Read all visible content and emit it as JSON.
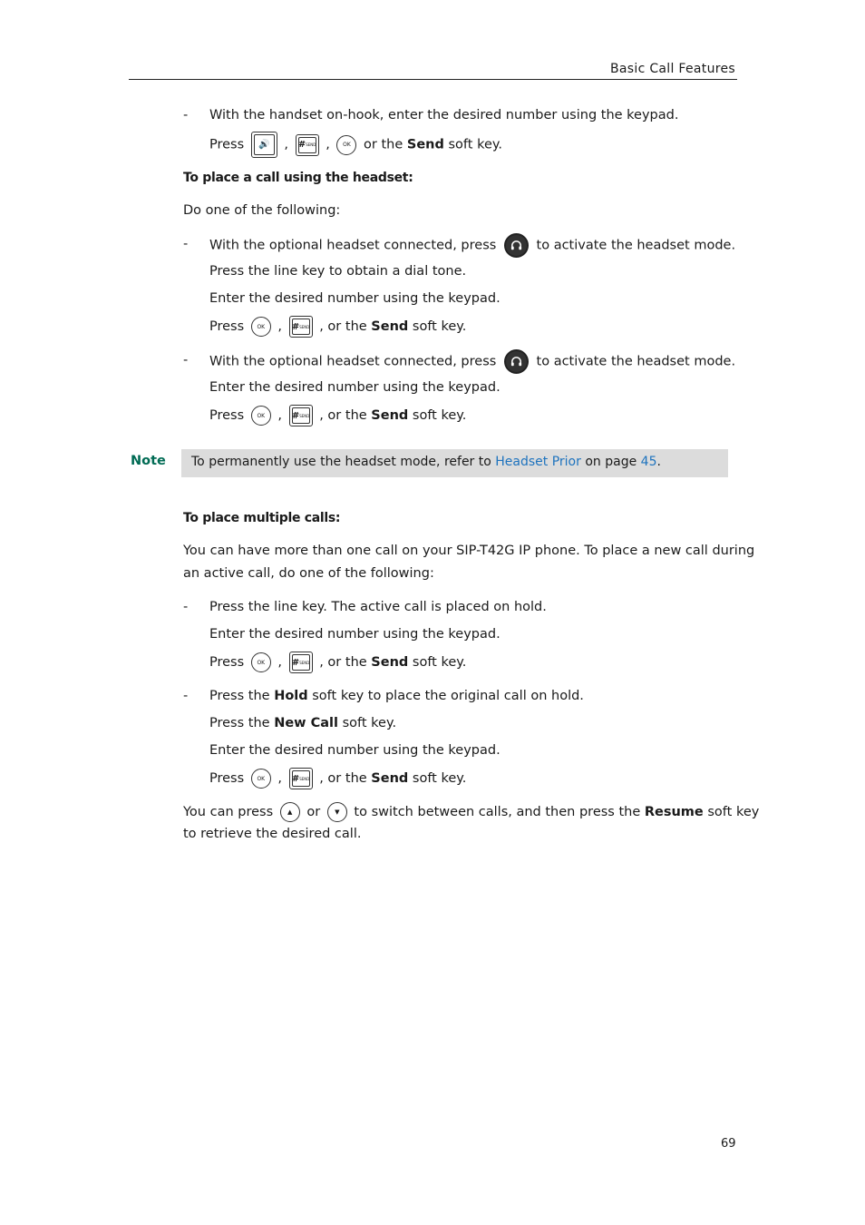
{
  "header": {
    "title": "Basic Call Features"
  },
  "section1": {
    "item_handset_text": "With the handset on-hook, enter the desired number using the keypad.",
    "press": "Press",
    "sep": ",",
    "or_the": "or the",
    "send": "Send",
    "soft_key": "soft key.",
    "comma_or_the": ", or the"
  },
  "headset": {
    "heading": "To place a call using the headset:",
    "intro": "Do one of the following:",
    "item1": {
      "text_before": "With the optional headset connected, press",
      "text_after": "to activate the headset mode.",
      "line2": "Press the line key to obtain a dial tone.",
      "line3": "Enter the desired number using the keypad."
    },
    "item2": {
      "text_before": "With the optional headset connected, press",
      "text_after": "to activate the headset mode.",
      "line2": "Enter the desired number using the keypad."
    }
  },
  "note": {
    "label": "Note",
    "text_before": "To permanently use the headset mode, refer to",
    "link": "Headset Prior",
    "text_mid": "on page",
    "page_link": "45",
    "text_end": "."
  },
  "multiple": {
    "heading": "To place multiple calls:",
    "intro_line1": "You can have more than one call on your SIP-T42G IP phone. To place a new call during",
    "intro_line2": "an active call, do one of the following:",
    "item1": {
      "line1": "Press the line key. The active call is placed on hold.",
      "line2": "Enter the desired number using the keypad."
    },
    "item2": {
      "line1_a": "Press the",
      "hold": "Hold",
      "line1_b": "soft key to place the original call on hold.",
      "line2_a": "Press the",
      "new_call": "New Call",
      "line2_b": "soft key.",
      "line3": "Enter the desired number using the keypad."
    },
    "switch": {
      "a": "You can press",
      "or": "or",
      "b": "to switch between calls, and then press the",
      "resume": "Resume",
      "c": "soft key",
      "line2": "to retrieve the desired call."
    }
  },
  "keys": {
    "ok": "OK",
    "hash": "#",
    "send_small": "SEND"
  },
  "dash": "-",
  "page_number": "69"
}
